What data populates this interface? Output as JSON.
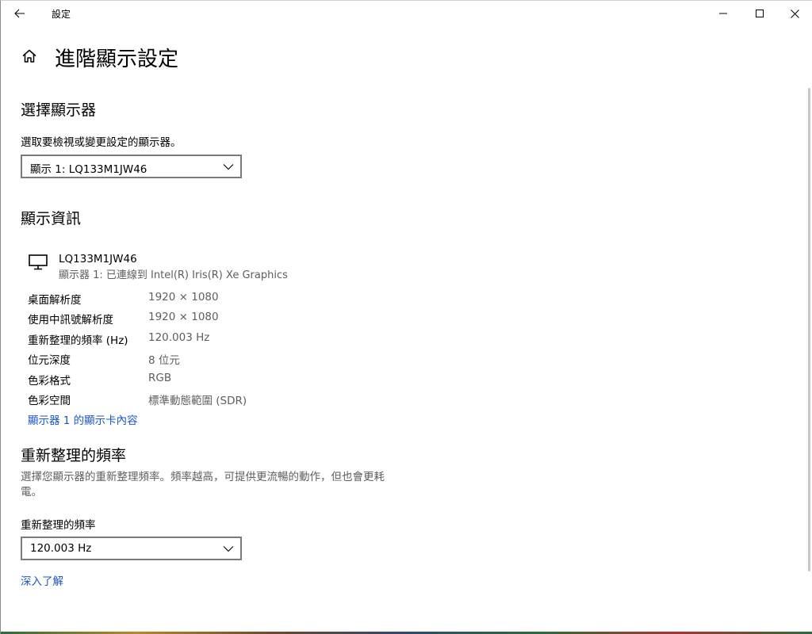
{
  "titlebar": {
    "app_title": "設定",
    "back_icon": "back-arrow-icon",
    "minimize_icon": "minimize-icon",
    "maximize_icon": "maximize-icon",
    "close_icon": "close-icon"
  },
  "header": {
    "home_icon": "home-icon",
    "title": "進階顯示設定"
  },
  "select_display": {
    "heading": "選擇顯示器",
    "prompt": "選取要檢視或變更設定的顯示器。",
    "dropdown_value": "顯示 1: LQ133M1JW46"
  },
  "display_info": {
    "heading": "顯示資訊",
    "monitor_icon": "monitor-icon",
    "monitor_name": "LQ133M1JW46",
    "monitor_sub": "顯示器 1: 已連線到 Intel(R) Iris(R) Xe Graphics",
    "rows": [
      {
        "label": "桌面解析度",
        "value": "1920 × 1080"
      },
      {
        "label": "使用中訊號解析度",
        "value": "1920 × 1080"
      },
      {
        "label": "重新整理的頻率 (Hz)",
        "value": "120.003 Hz"
      },
      {
        "label": "位元深度",
        "value": "8 位元"
      },
      {
        "label": "色彩格式",
        "value": "RGB"
      },
      {
        "label": "色彩空間",
        "value": "標準動態範圍 (SDR)"
      }
    ],
    "adapter_link": "顯示器 1 的顯示卡內容"
  },
  "refresh_rate": {
    "heading": "重新整理的頻率",
    "description": "選擇您顯示器的重新整理頻率。頻率越高，可提供更流暢的動作，但也會更耗電。",
    "field_label": "重新整理的頻率",
    "dropdown_value": "120.003 Hz",
    "learn_more_link": "深入了解"
  },
  "colors": {
    "link": "#1a55c9",
    "secondary_text": "#5e5e5e",
    "dropdown_border": "#7a7a7a"
  }
}
